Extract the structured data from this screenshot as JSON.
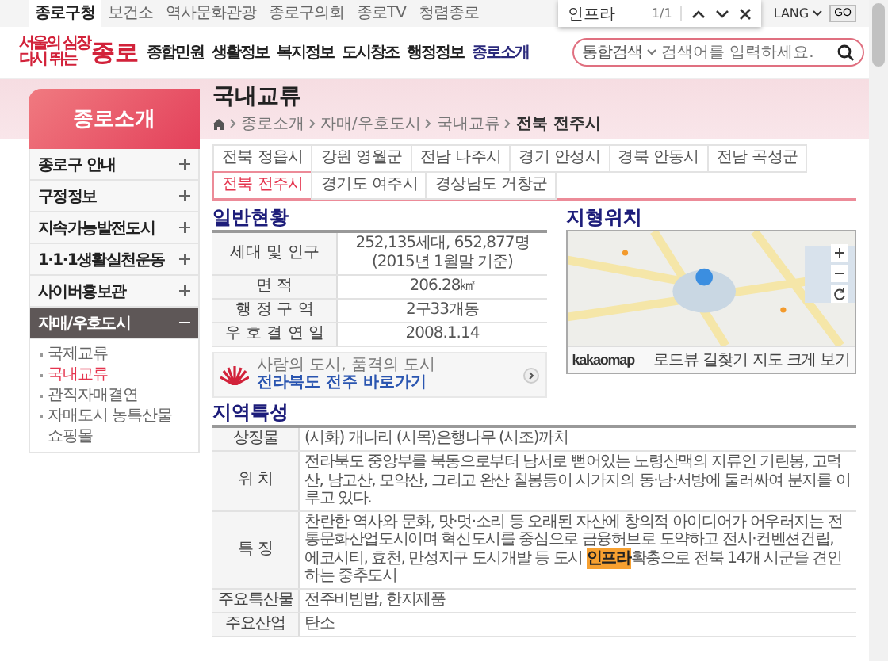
{
  "top_links": [
    {
      "label": "종로구청",
      "selected": true
    },
    {
      "label": "보건소",
      "selected": false
    },
    {
      "label": "역사문화관광",
      "selected": false
    },
    {
      "label": "종로구의회",
      "selected": false
    },
    {
      "label": "종로TV",
      "selected": false
    },
    {
      "label": "청렴종로",
      "selected": false
    }
  ],
  "find_bar": {
    "query": "인프라",
    "count": "1/1"
  },
  "lang": {
    "label": "LANG",
    "button": "GO"
  },
  "logo": {
    "line1": "서울의 심장",
    "line2": "다시 뛰는",
    "name": "종로"
  },
  "nav": [
    {
      "label": "종합민원",
      "selected": false
    },
    {
      "label": "생활정보",
      "selected": false
    },
    {
      "label": "복지정보",
      "selected": false
    },
    {
      "label": "도시창조",
      "selected": false
    },
    {
      "label": "행정정보",
      "selected": false
    },
    {
      "label": "종로소개",
      "selected": true
    }
  ],
  "search": {
    "scope": "통합검색",
    "placeholder": "검색어를 입력하세요."
  },
  "sidebar": {
    "title": "종로소개",
    "items": [
      {
        "label": "종로구 안내",
        "expanded": false
      },
      {
        "label": "구정정보",
        "expanded": false
      },
      {
        "label": "지속가능발전도시",
        "expanded": false
      },
      {
        "label": "1·1·1생활실천운동",
        "expanded": false
      },
      {
        "label": "사이버홍보관",
        "expanded": false
      },
      {
        "label": "자매/우호도시",
        "expanded": true,
        "children": [
          {
            "label": "국제교류",
            "selected": false
          },
          {
            "label": "국내교류",
            "selected": true
          },
          {
            "label": "관직자매결연",
            "selected": false
          },
          {
            "label": "자매도시 농특산물 쇼핑몰",
            "selected": false
          }
        ]
      }
    ]
  },
  "page_title": "국내교류",
  "breadcrumb": [
    "종로소개",
    "자매/우호도시",
    "국내교류",
    "전북 전주시"
  ],
  "tabs": [
    {
      "label": "전북 정읍시",
      "selected": false
    },
    {
      "label": "강원 영월군",
      "selected": false
    },
    {
      "label": "전남 나주시",
      "selected": false
    },
    {
      "label": "경기 안성시",
      "selected": false
    },
    {
      "label": "경북 안동시",
      "selected": false
    },
    {
      "label": "전남 곡성군",
      "selected": false
    },
    {
      "label": "전북 전주시",
      "selected": true
    },
    {
      "label": "경기도 여주시",
      "selected": false
    },
    {
      "label": "경상남도 거창군",
      "selected": false
    }
  ],
  "general": {
    "heading": "일반현황",
    "rows": [
      {
        "label": "세대 및 인구",
        "value": "252,135세대, 652,877명",
        "note": "(2015년 1월말 기준)"
      },
      {
        "label": "면 적",
        "value": "206.28㎢"
      },
      {
        "label": "행 정 구 역",
        "value": "2구33개동"
      },
      {
        "label": "우 호 결 연 일",
        "value": "2008.1.14"
      }
    ]
  },
  "banner": {
    "caption": "사람의 도시, 품격의 도시",
    "link": "전라북도 전주 바로가기"
  },
  "location": {
    "heading": "지형위치",
    "map_brand": "kakaomap",
    "map_links": [
      "로드뷰",
      "길찾기",
      "지도 크게 보기"
    ]
  },
  "features": {
    "heading": "지역특성",
    "rows": [
      {
        "label": "상징물",
        "before": "(시화) 개나리 (시목)은행나무 (시조)까치"
      },
      {
        "label": "위 치",
        "before": "전라북도 중앙부를 북동으로부터 남서로 뻗어있는 노령산맥의 지류인 기린봉, 고덕산, 남고산, 모악산, 그리고 완산 칠봉등이 시가지의 동·남·서방에 둘러싸여 분지를 이루고 있다."
      },
      {
        "label": "특 징",
        "before": "찬란한 역사와 문화, 맛·멋·소리 등 오래된 자산에 창의적 아이디어가 어우러지는 전통문화산업도시이며 혁신도시를 중심으로 금융허브로 도약하고 전시·컨벤션건립, 에코시티, 효천, 만성지구 도시개발 등 도시 ",
        "highlight": "인프라",
        "after": "확충으로 전북 14개 시군을 견인하는 중추도시"
      },
      {
        "label": "주요특산물",
        "before": "전주비빔밥, 한지제품"
      },
      {
        "label": "주요산업",
        "before": "탄소"
      }
    ]
  }
}
